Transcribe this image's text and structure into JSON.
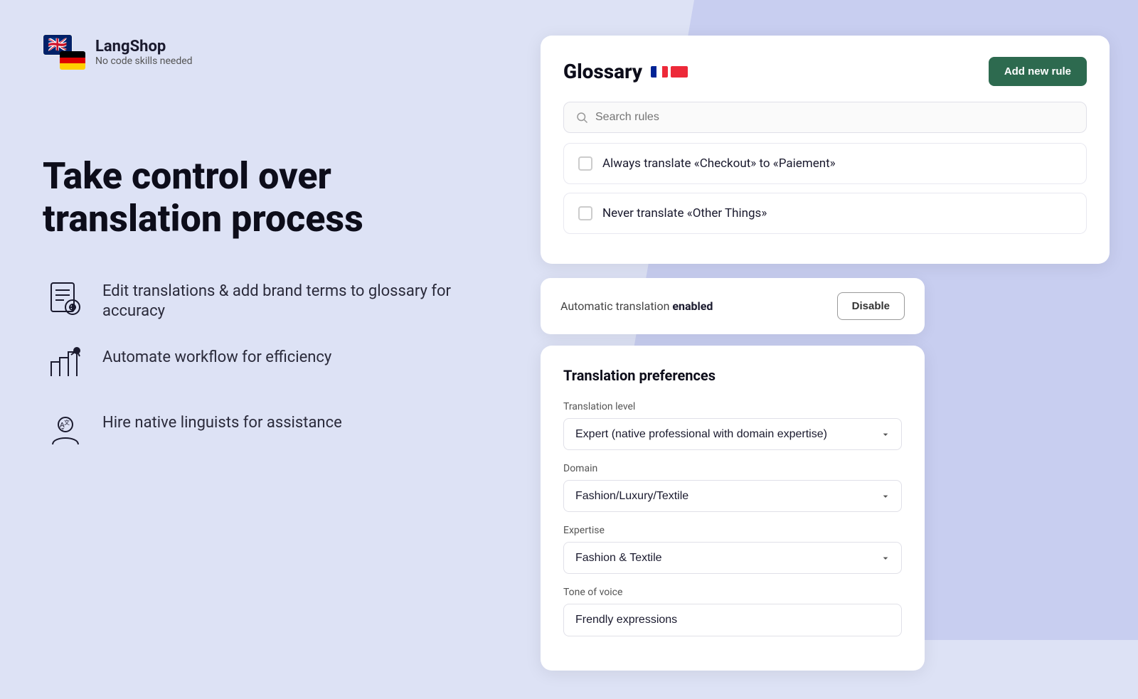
{
  "app": {
    "name": "LangShop",
    "tagline": "No code skills needed"
  },
  "hero": {
    "headline": "Take control over translation process"
  },
  "features": [
    {
      "id": "edit",
      "text": "Edit translations & add brand terms to glossary for accuracy"
    },
    {
      "id": "automate",
      "text": "Automate workflow for efficiency"
    },
    {
      "id": "hire",
      "text": "Hire native linguists for assistance"
    }
  ],
  "glossary": {
    "title": "Glossary",
    "add_rule_label": "Add new rule",
    "search_placeholder": "Search rules",
    "rules": [
      {
        "id": "rule1",
        "text": "Always translate «Checkout» to «Paiement»",
        "checked": false
      },
      {
        "id": "rule2",
        "text": "Never translate «Other Things»",
        "checked": false
      }
    ]
  },
  "auto_translation": {
    "label": "Automatic translation",
    "status": "enabled",
    "disable_label": "Disable"
  },
  "preferences": {
    "title": "Translation preferences",
    "fields": {
      "level_label": "Translation level",
      "level_value": "Expert (native professional with domain expertise)",
      "domain_label": "Domain",
      "domain_value": "Fashion/Luxury/Textile",
      "expertise_label": "Expertise",
      "expertise_value": "Fashion & Textile",
      "tone_label": "Tone of voice",
      "tone_value": "Frendly expressions"
    }
  },
  "colors": {
    "add_rule_bg": "#2d6a4f",
    "bg_main": "#dde2f5",
    "bg_shape": "#c8cef0"
  }
}
